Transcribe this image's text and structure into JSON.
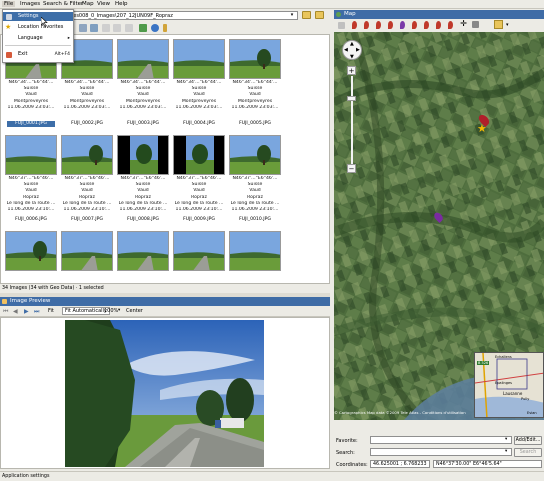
{
  "menu": {
    "items": [
      "File",
      "Images",
      "Search & Filter",
      "Map",
      "View",
      "Help"
    ],
    "file_menu": [
      {
        "label": "Settings",
        "shortcut": ""
      },
      {
        "label": "Location Favorites",
        "shortcut": ""
      },
      {
        "label": "Language",
        "shortcut": "▸"
      },
      {
        "label": "Exit",
        "shortcut": "Alt+F4"
      }
    ]
  },
  "path": {
    "value": "ages008_0_Images\\207_12JUN09F_Ropraz"
  },
  "thumbnails": [
    {
      "coords": "N46°34'...°E6°44'...",
      "lines": [
        "Suisse",
        "Vaud",
        "Montpreveyres",
        "11.06.2009 23:03:..."
      ],
      "file": "FUJI_0001.JPG",
      "selected": true,
      "scene": "road"
    },
    {
      "coords": "N46°34'...°E6°44'...",
      "lines": [
        "Suisse",
        "Vaud",
        "Montpreveyres",
        "11.06.2009 23:03:..."
      ],
      "file": "FUJI_0002.JPG",
      "selected": false,
      "scene": "field"
    },
    {
      "coords": "N46°34'...°E6°44'...",
      "lines": [
        "Suisse",
        "Vaud",
        "Montpreveyres",
        "11.06.2009 23:03:..."
      ],
      "file": "FUJI_0003.JPG",
      "selected": false,
      "scene": "road"
    },
    {
      "coords": "N46°34'...°E6°44'...",
      "lines": [
        "Suisse",
        "Vaud",
        "Montpreveyres",
        "11.06.2009 23:03:..."
      ],
      "file": "FUJI_0004.JPG",
      "selected": false,
      "scene": "field"
    },
    {
      "coords": "N46°34'...°E6°44'...",
      "lines": [
        "Suisse",
        "Vaud",
        "Montpreveyres",
        "11.06.2009 23:03:..."
      ],
      "file": "FUJI_0005.JPG",
      "selected": false,
      "scene": "tree"
    },
    {
      "coords": "N46°37'...°E6°46'...",
      "lines": [
        "Suisse",
        "Vaud",
        "Ropraz",
        "Le long de la route ...",
        "11.06.2009 23:10:..."
      ],
      "file": "FUJI_0006.JPG",
      "selected": false,
      "scene": "field"
    },
    {
      "coords": "N46°37'...°E6°46'...",
      "lines": [
        "Suisse",
        "Vaud",
        "Ropraz",
        "Le long de la route ...",
        "11.06.2009 23:10:..."
      ],
      "file": "FUJI_0007.JPG",
      "selected": false,
      "scene": "tree"
    },
    {
      "coords": "N46°37'...°E6°46'...",
      "lines": [
        "Suisse",
        "Vaud",
        "Ropraz",
        "Le long de la route ...",
        "11.06.2009 23:10:..."
      ],
      "file": "FUJI_0008.JPG",
      "selected": false,
      "scene": "portrait"
    },
    {
      "coords": "N46°37'...°E6°46'...",
      "lines": [
        "Suisse",
        "Vaud",
        "Ropraz",
        "Le long de la route ...",
        "11.06.2009 23:10:..."
      ],
      "file": "FUJI_0009.JPG",
      "selected": false,
      "scene": "portrait"
    },
    {
      "coords": "N46°37'...°E6°46'...",
      "lines": [
        "Suisse",
        "Vaud",
        "Ropraz",
        "Le long de la route ...",
        "11.06.2009 23:10:..."
      ],
      "file": "FUJI_0010.JPG",
      "selected": false,
      "scene": "tree"
    },
    {
      "coords": "",
      "lines": [],
      "file": "",
      "selected": false,
      "scene": "tree"
    },
    {
      "coords": "",
      "lines": [],
      "file": "",
      "selected": false,
      "scene": "road"
    },
    {
      "coords": "",
      "lines": [],
      "file": "",
      "selected": false,
      "scene": "road"
    },
    {
      "coords": "",
      "lines": [],
      "file": "",
      "selected": false,
      "scene": "road"
    },
    {
      "coords": "",
      "lines": [],
      "file": "",
      "selected": false,
      "scene": "field"
    }
  ],
  "status": {
    "images": "34 Images (34 with Geo Data) · 1 selected",
    "bottom": "Application settings"
  },
  "preview": {
    "title": "Image Preview",
    "fit_label": "Fit",
    "fit_mode": "Fit Automatically",
    "zoom": "100%",
    "center_label": "Center"
  },
  "map": {
    "title": "Map",
    "attribution": "Map data ©2009 Tele Atlas - Conditions d'utilisation",
    "attribution_prefix": "© Cartographics",
    "inset_labels": [
      "B 526",
      "Echallens",
      "Epalinges",
      "Lausanne",
      "Pully",
      "Evian"
    ]
  },
  "form": {
    "favorite_label": "Favorite:",
    "add_edit_label": "Add/Edit...",
    "search_label": "Search:",
    "search_button": "Search",
    "coordinates_label": "Coordinates:",
    "coord_decimal": "46.625001 ; 6.768233",
    "coord_dms": "N46°37'30.00\" E6°46'5.64\""
  },
  "colors": {
    "title_bar": "#3f6ca6",
    "selection": "#3d6ea8",
    "map_green": "#3d5a32"
  }
}
